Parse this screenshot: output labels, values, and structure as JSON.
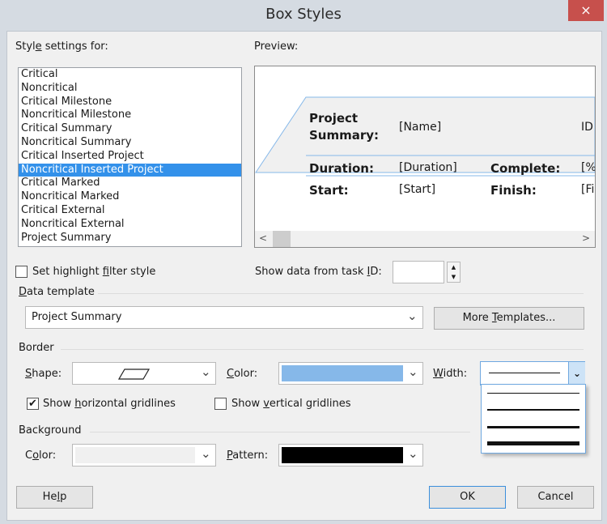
{
  "window": {
    "title": "Box Styles",
    "close_glyph": "×"
  },
  "style_settings": {
    "label_pre": "Styl",
    "label_u": "e",
    "label_post": " settings for:",
    "items": [
      "Critical",
      "Noncritical",
      "Critical Milestone",
      "Noncritical Milestone",
      "Critical Summary",
      "Noncritical Summary",
      "Critical Inserted Project",
      "Noncritical Inserted Project",
      "Critical Marked",
      "Noncritical Marked",
      "Critical External",
      "Noncritical External",
      "Project Summary"
    ],
    "selected": "Noncritical Inserted Project"
  },
  "preview": {
    "label": "Preview:",
    "title_label_1": "Project",
    "title_label_2": "Summary:",
    "name_field": "[Name]",
    "id_field": "ID",
    "duration_label": "Duration:",
    "duration_field": "[Duration]",
    "complete_label": "Complete:",
    "complete_field": "[%",
    "start_label": "Start:",
    "start_field": "[Start]",
    "finish_label": "Finish:",
    "finish_field": "[Fi",
    "scroll_left": "<",
    "scroll_right": ">"
  },
  "highlight_filter": {
    "pre": "Set highlight ",
    "u": "f",
    "post": "ilter style",
    "checked": false
  },
  "task_id": {
    "pre": "Show data from task ",
    "u": "I",
    "post": "D:",
    "value": ""
  },
  "data_template": {
    "label_u": "D",
    "label_post": "ata template",
    "value": "Project Summary",
    "more_pre": "More ",
    "more_u": "T",
    "more_post": "emplates..."
  },
  "border": {
    "section": "Border",
    "shape_u": "S",
    "shape_post": "hape:",
    "color_u": "C",
    "color_post": "olor:",
    "color_value": "#86b8e9",
    "width_u": "W",
    "width_post": "idth:",
    "width_options_count": 4,
    "horizontal_pre": "Show ",
    "horizontal_u": "h",
    "horizontal_post": "orizontal gridlines",
    "horizontal_checked": true,
    "vertical_pre": "Show ",
    "vertical_u": "v",
    "vertical_post": "ertical gridlines",
    "vertical_checked": false
  },
  "background": {
    "section": "Background",
    "color_pre": "C",
    "color_u": "o",
    "color_post": "lor:",
    "color_value": "#f0f0f0",
    "pattern_u": "P",
    "pattern_post": "attern:",
    "pattern_value": "#000000"
  },
  "buttons": {
    "help_pre": "He",
    "help_u": "l",
    "help_post": "p",
    "ok": "OK",
    "cancel": "Cancel"
  },
  "glyphs": {
    "chevron": "⌄",
    "check": "✔",
    "up": "▲",
    "down": "▼"
  }
}
